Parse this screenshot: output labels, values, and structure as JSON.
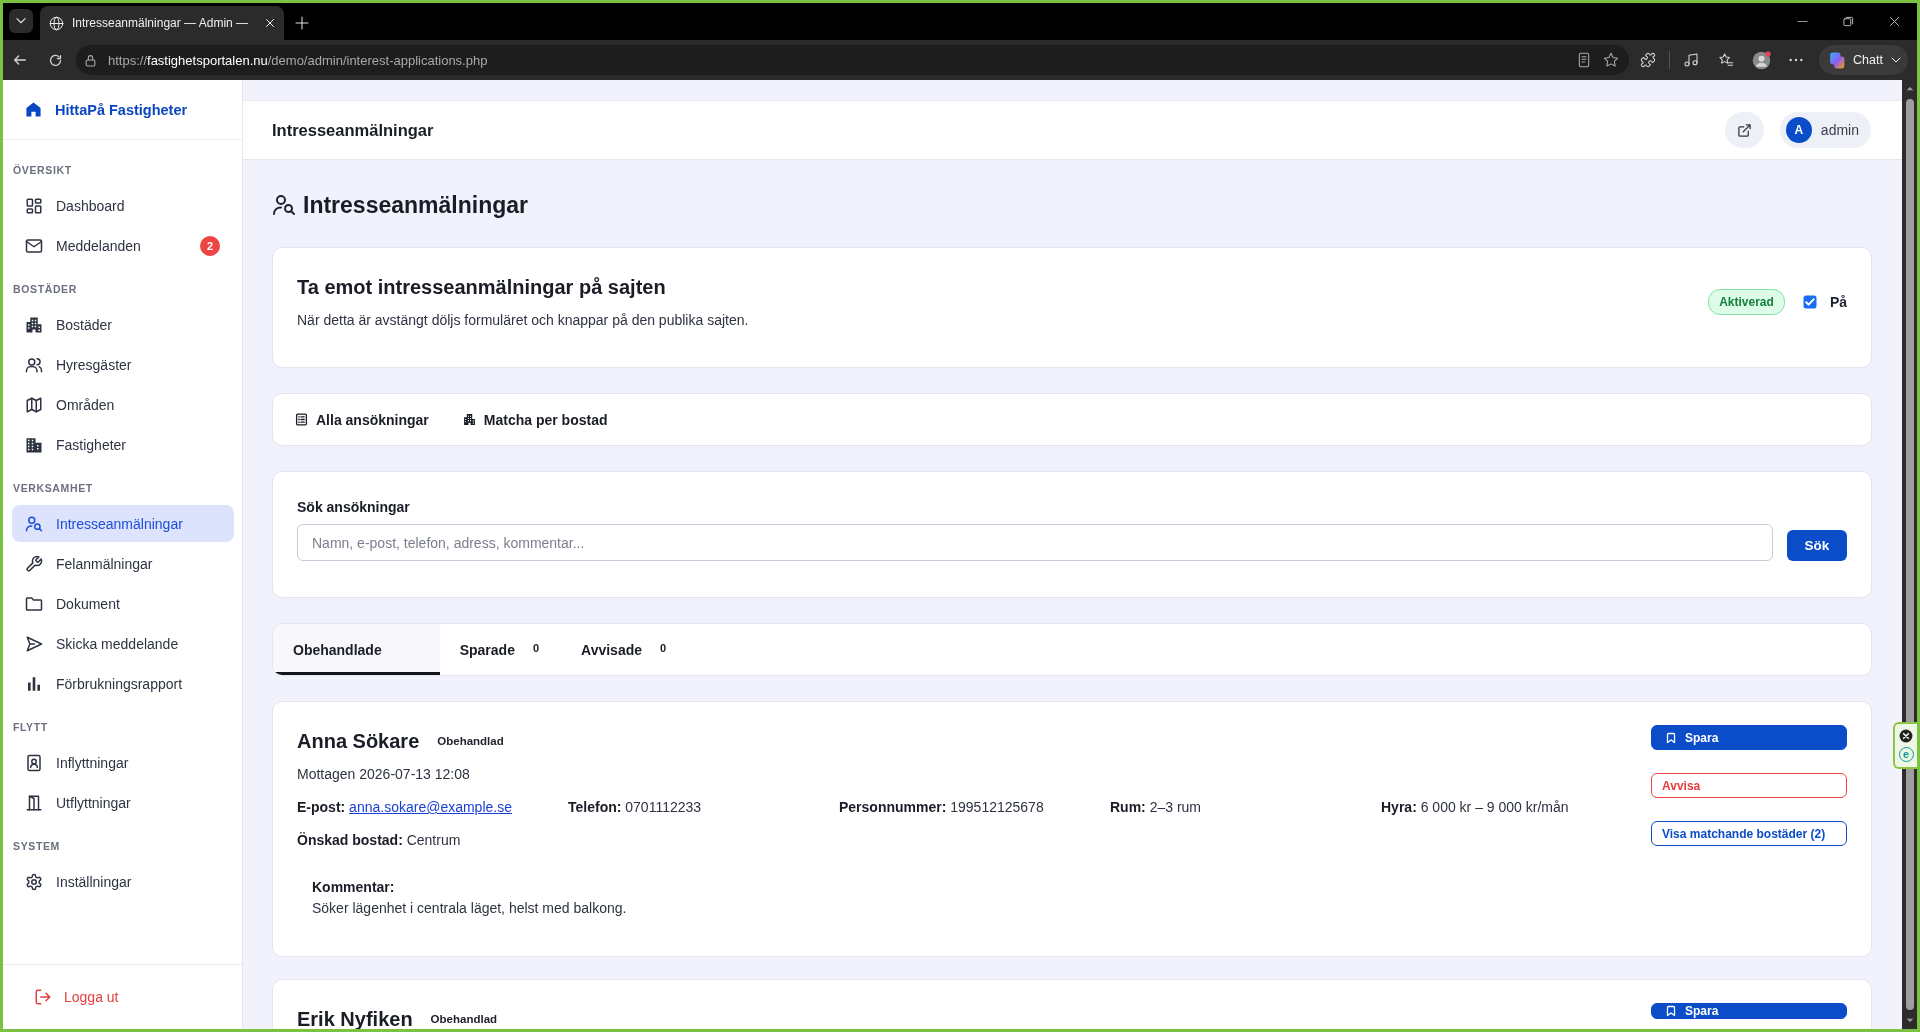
{
  "browser": {
    "tab_title": "Intresseanmälningar — Admin —",
    "url": "https://**fastighetsportalen.nu**/demo/admin/interest-applications.php",
    "chat_label": "Chatt"
  },
  "sidebar": {
    "brand": "HittaPå Fastigheter",
    "sections": [
      {
        "title": "ÖVERSIKT",
        "items": [
          {
            "label": "Dashboard",
            "selected": false
          },
          {
            "label": "Meddelanden",
            "selected": false,
            "badge": "2"
          }
        ]
      },
      {
        "title": "BOSTÄDER",
        "items": [
          {
            "label": "Bostäder",
            "selected": false
          },
          {
            "label": "Hyresgäster",
            "selected": false
          },
          {
            "label": "Områden",
            "selected": false
          },
          {
            "label": "Fastigheter",
            "selected": false
          }
        ]
      },
      {
        "title": "VERKSAMHET",
        "items": [
          {
            "label": "Intresseanmälningar",
            "selected": true
          },
          {
            "label": "Felanmälningar",
            "selected": false
          },
          {
            "label": "Dokument",
            "selected": false
          },
          {
            "label": "Skicka meddelande",
            "selected": false
          },
          {
            "label": "Förbrukningsrapport",
            "selected": false
          }
        ]
      },
      {
        "title": "FLYTT",
        "items": [
          {
            "label": "Inflyttningar",
            "selected": false
          },
          {
            "label": "Utflyttningar",
            "selected": false
          }
        ]
      },
      {
        "title": "SYSTEM",
        "items": [
          {
            "label": "Inställningar",
            "selected": false
          }
        ]
      }
    ],
    "logout": "Logga ut"
  },
  "header": {
    "title": "Intresseanmälningar",
    "user_initial": "A",
    "user_name": "admin"
  },
  "page_title": "Intresseanmälningar",
  "setting_card": {
    "title": "Ta emot intresseanmälningar på sajten",
    "description": "När detta är avstängt döljs formuläret och knappar på den publika sajten.",
    "status": "Aktiverad",
    "checked": true,
    "checkbox_label": "På"
  },
  "view_links": [
    "Alla ansökningar",
    "Matcha per bostad"
  ],
  "search": {
    "label": "Sök ansökningar",
    "placeholder": "Namn, e-post, telefon, adress, kommentar...",
    "button": "Sök"
  },
  "status_tabs": [
    {
      "label": "Obehandlade",
      "selected": true
    },
    {
      "label": "Sparade",
      "count": "0",
      "selected": false
    },
    {
      "label": "Avvisade",
      "count": "0",
      "selected": false
    }
  ],
  "applications": [
    {
      "name": "Anna Sökare",
      "status": "Obehandlad",
      "received": "Mottagen 2026-07-13 12:08",
      "fields": [
        {
          "label": "E-post:",
          "value": "anna.sokare@example.se",
          "kind": "link"
        },
        {
          "label": "Telefon:",
          "value": "0701112233",
          "kind": "text"
        },
        {
          "label": "Personnummer:",
          "value": "199512125678",
          "kind": "text"
        },
        {
          "label": "Rum:",
          "value": "2–3 rum",
          "kind": "text"
        },
        {
          "label": "Hyra:",
          "value": "6 000 kr – 9 000 kr/mån",
          "kind": "text"
        }
      ],
      "wish": {
        "label": "Önskad bostad:",
        "value": "Centrum"
      },
      "comment": {
        "label": "Kommentar:",
        "text": "Söker lägenhet i centrala läget, helst med balkong."
      },
      "actions": [
        {
          "label": "Spara",
          "kind": "primary"
        },
        {
          "label": "Avvisa",
          "kind": "danger"
        },
        {
          "label": "Visa matchande bostäder (2)",
          "kind": "outline"
        }
      ]
    },
    {
      "name": "Erik Nyfiken",
      "status": "Obehandlad",
      "actions": [
        {
          "label": "Spara",
          "kind": "primary"
        }
      ]
    }
  ],
  "extension": {
    "logo": "e"
  }
}
